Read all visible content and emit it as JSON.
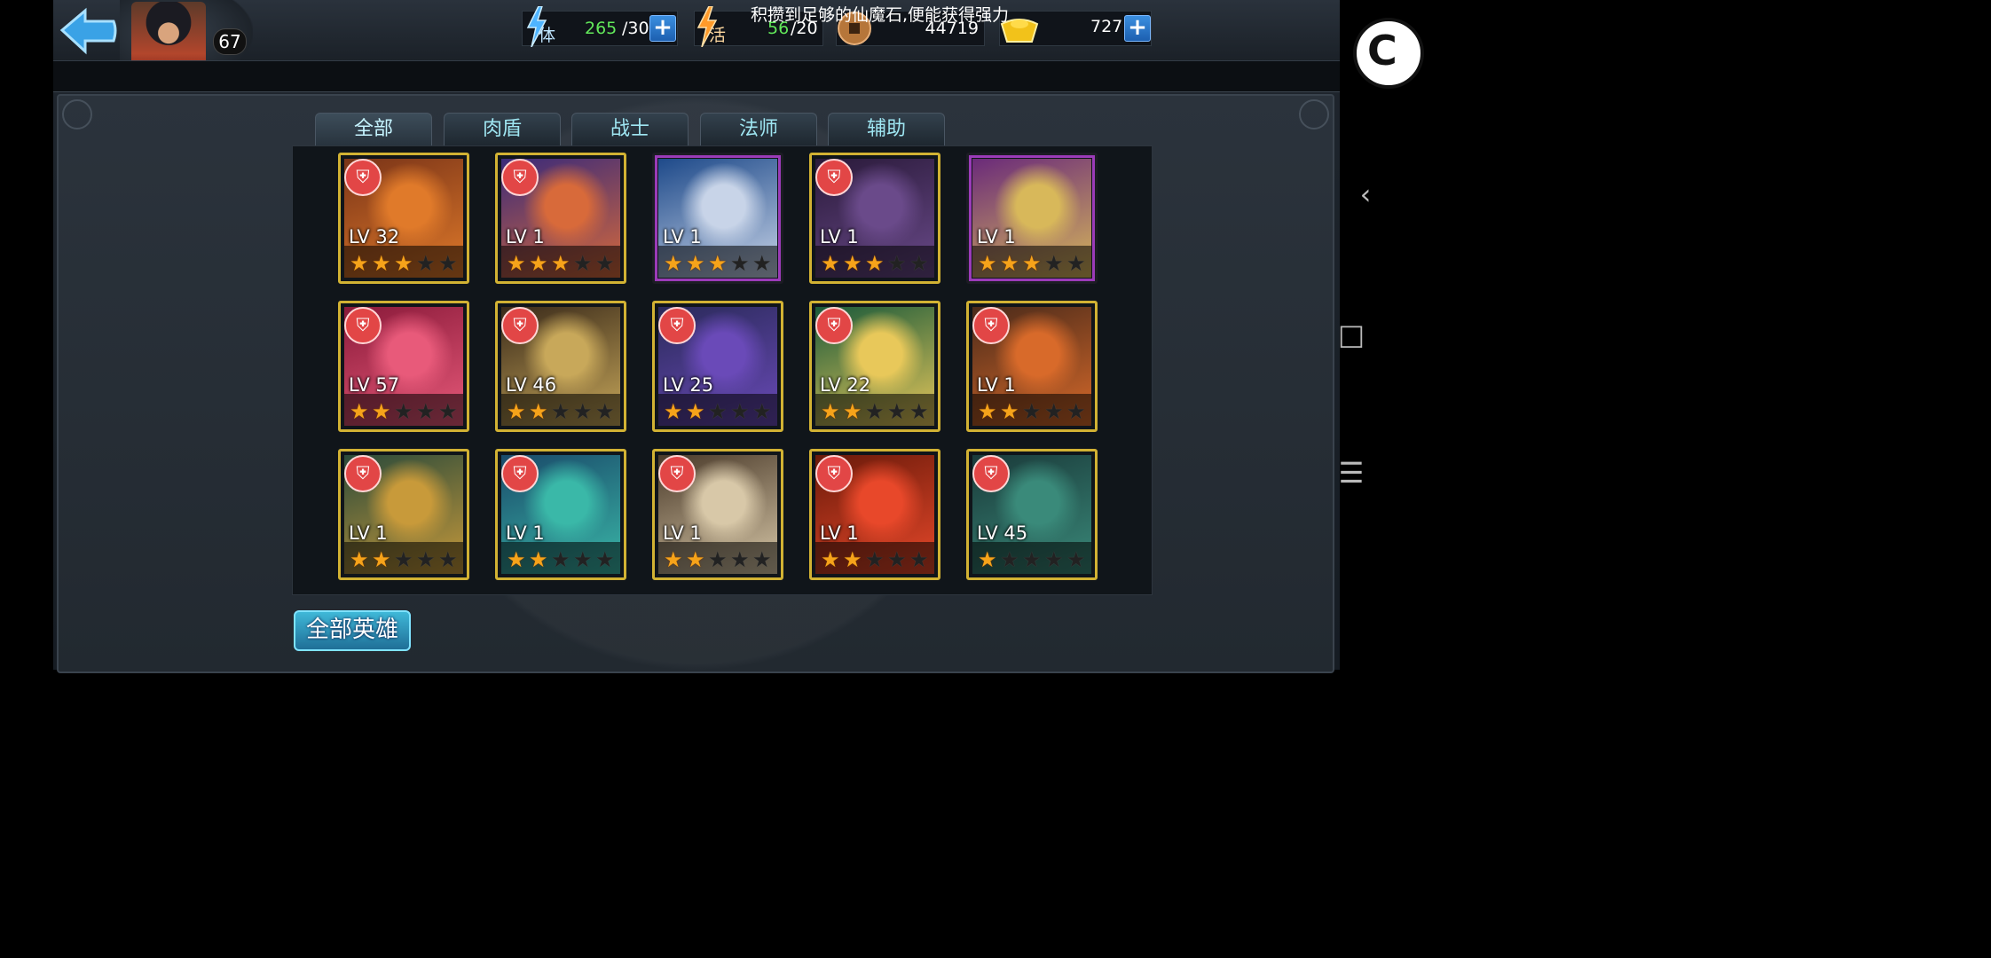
{
  "player": {
    "level": "67"
  },
  "resources": {
    "stamina": {
      "label": "体",
      "current": "265",
      "max": "/30"
    },
    "vitality": {
      "label": "活",
      "current": "56",
      "max": "/20"
    },
    "coins": {
      "value": "44719"
    },
    "gold": {
      "value": "727"
    },
    "plus": "+"
  },
  "ticker": {
    "text": "积攒到足够的仙魔石,便能获得强力"
  },
  "tabs": [
    {
      "label": "全部"
    },
    {
      "label": "肉盾"
    },
    {
      "label": "战士"
    },
    {
      "label": "法师"
    },
    {
      "label": "辅助"
    }
  ],
  "heroes": [
    {
      "level": "LV 32",
      "stars": 3,
      "frame": "gold",
      "role_icon": true
    },
    {
      "level": "LV 1",
      "stars": 3,
      "frame": "gold",
      "role_icon": true
    },
    {
      "level": "LV 1",
      "stars": 3,
      "frame": "purple",
      "role_icon": false
    },
    {
      "level": "LV 1",
      "stars": 3,
      "frame": "gold",
      "role_icon": true
    },
    {
      "level": "LV 1",
      "stars": 3,
      "frame": "purple",
      "role_icon": false
    },
    {
      "level": "LV 57",
      "stars": 2,
      "frame": "gold",
      "role_icon": true
    },
    {
      "level": "LV 46",
      "stars": 2,
      "frame": "gold",
      "role_icon": true
    },
    {
      "level": "LV 25",
      "stars": 2,
      "frame": "gold",
      "role_icon": true
    },
    {
      "level": "LV 22",
      "stars": 2,
      "frame": "gold",
      "role_icon": true
    },
    {
      "level": "LV 1",
      "stars": 2,
      "frame": "gold",
      "role_icon": true
    },
    {
      "level": "LV 1",
      "stars": 2,
      "frame": "gold",
      "role_icon": true
    },
    {
      "level": "LV 1",
      "stars": 2,
      "frame": "gold",
      "role_icon": true
    },
    {
      "level": "LV 1",
      "stars": 2,
      "frame": "gold",
      "role_icon": true
    },
    {
      "level": "LV 1",
      "stars": 2,
      "frame": "gold",
      "role_icon": true
    },
    {
      "level": "LV 45",
      "stars": 1,
      "frame": "gold",
      "role_icon": true
    }
  ],
  "footer": {
    "all_heroes_label": "全部英雄"
  },
  "nav": {
    "back_glyph": "‹",
    "home_glyph": "□",
    "menu_glyph": "☰",
    "round_glyph": "C"
  }
}
